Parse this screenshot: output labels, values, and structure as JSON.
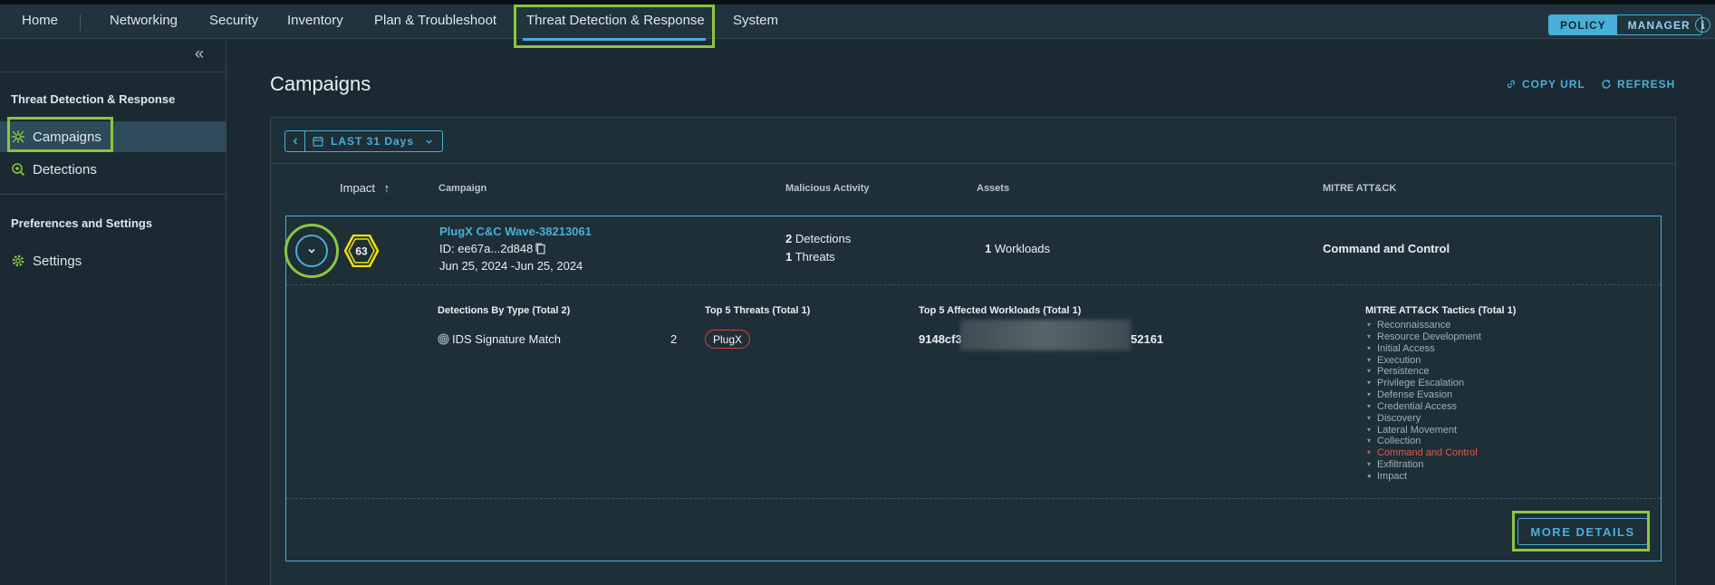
{
  "topnav": {
    "items": [
      "Home",
      "Networking",
      "Security",
      "Inventory",
      "Plan & Troubleshoot",
      "Threat Detection & Response",
      "System"
    ],
    "active": "Threat Detection & Response",
    "mode_toggle": [
      "POLICY",
      "MANAGER"
    ],
    "mode_selected": "POLICY",
    "info_icon": "i"
  },
  "sidebar": {
    "collapse_icon": "«",
    "section1": "Threat Detection & Response",
    "items": [
      {
        "label": "Campaigns",
        "icon": "campaign-icon",
        "active": true
      },
      {
        "label": "Detections",
        "icon": "detections-icon",
        "active": false
      }
    ],
    "section2": "Preferences and Settings",
    "settings": {
      "label": "Settings",
      "icon": "gear-icon"
    }
  },
  "main": {
    "title": "Campaigns",
    "copy_url": "COPY URL",
    "refresh": "REFRESH",
    "filter": {
      "prev_icon": "chevron-left-icon",
      "label": "LAST 31 Days",
      "dropdown_icon": "chevron-down-icon"
    },
    "columns": {
      "impact": "Impact",
      "impact_sort_icon": "↑",
      "campaign": "Campaign",
      "malicious": "Malicious Activity",
      "assets": "Assets",
      "mitre": "MITRE ATT&CK"
    },
    "row": {
      "impact": "63",
      "campaign_name": "PlugX C&C Wave-38213061",
      "campaign_id": "ID: ee67a...2d848",
      "date_range": "Jun 25, 2024 -Jun 25, 2024",
      "detections_count": "2",
      "detections_label": " Detections",
      "threats_count": "1",
      "threats_label": " Threats",
      "workloads_count": "1",
      "workloads_label": " Workloads",
      "mitre_tactic": "Command and Control"
    },
    "details": {
      "by_type_heading": "Detections By Type (Total 2)",
      "by_type": [
        {
          "label": "IDS Signature Match",
          "count": "2"
        }
      ],
      "threats_heading": "Top 5 Threats (Total 1)",
      "threats": [
        "PlugX"
      ],
      "workloads_heading": "Top 5 Affected Workloads (Total 1)",
      "workload_prefix": "9148cf3",
      "workload_suffix": "52161",
      "tactics_heading": "MITRE ATT&CK Tactics (Total 1)",
      "tactics": [
        "Reconnaissance",
        "Resource Development",
        "Initial Access",
        "Execution",
        "Persistence",
        "Privilege Escalation",
        "Defense Evasion",
        "Credential Access",
        "Discovery",
        "Lateral Movement",
        "Collection",
        "Command and Control",
        "Exfiltration",
        "Impact"
      ],
      "active_tactic": "Command and Control",
      "more_details": "MORE DETAILS"
    }
  },
  "colors": {
    "accent": "#49afd9",
    "highlight": "#8cc63f",
    "badge": "#f5e000",
    "threat": "#e0403a"
  }
}
